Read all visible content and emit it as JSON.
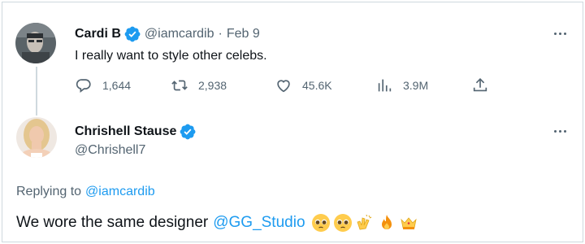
{
  "tweet": {
    "author_name": "Cardi B",
    "handle": "@iamcardib",
    "separator": "·",
    "date": "Feb 9",
    "text": "I really want to style other celebs.",
    "stats": {
      "replies": "1,644",
      "retweets": "2,938",
      "likes": "45.6K",
      "views": "3.9M"
    }
  },
  "reply": {
    "author_name": "Chrishell Stause",
    "handle": "@Chrishell7",
    "replying_prefix": "Replying to",
    "replying_handle": "@iamcardib",
    "text_prefix": "We wore the same designer",
    "mention": "@GG_Studio",
    "emojis": [
      "pleading-face-emoji",
      "pleading-face-emoji",
      "clapping-hands-emoji",
      "fire-emoji",
      "crown-emoji"
    ]
  },
  "colors": {
    "verified": "#1d9bf0",
    "link": "#1d9bf0",
    "muted": "#536471"
  }
}
